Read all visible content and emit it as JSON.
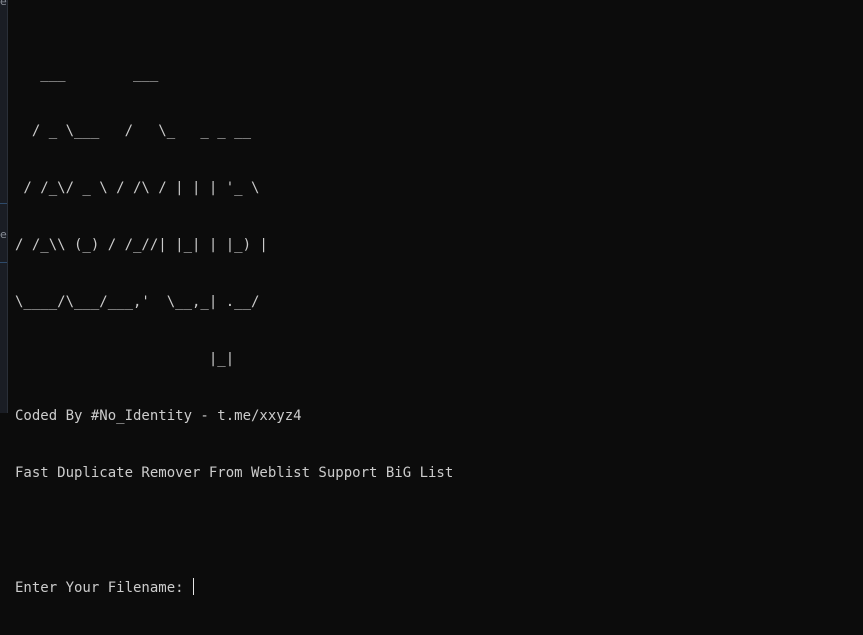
{
  "sidebar": {
    "fragment_top": "e",
    "fragment_mid": "er"
  },
  "terminal": {
    "banner": [
      "   ___        ___",
      "  / _ \\___   /   \\_   _ _ __",
      " / /_\\/ _ \\ / /\\ / | | | '_ \\",
      "/ /_\\\\ (_) / /_//| |_| | |_) |",
      "\\____/\\___/___,'  \\__,_| .__/",
      "                       |_|"
    ],
    "credit_line": "Coded By #No_Identity - t.me/xxyz4",
    "description_line": "Fast Duplicate Remover From Weblist Support BiG List",
    "prompt": "Enter Your Filename: ",
    "input_value": ""
  },
  "colors": {
    "background": "#0c0c0c",
    "text": "#cccccc",
    "cursor": "#e6e6e6"
  }
}
